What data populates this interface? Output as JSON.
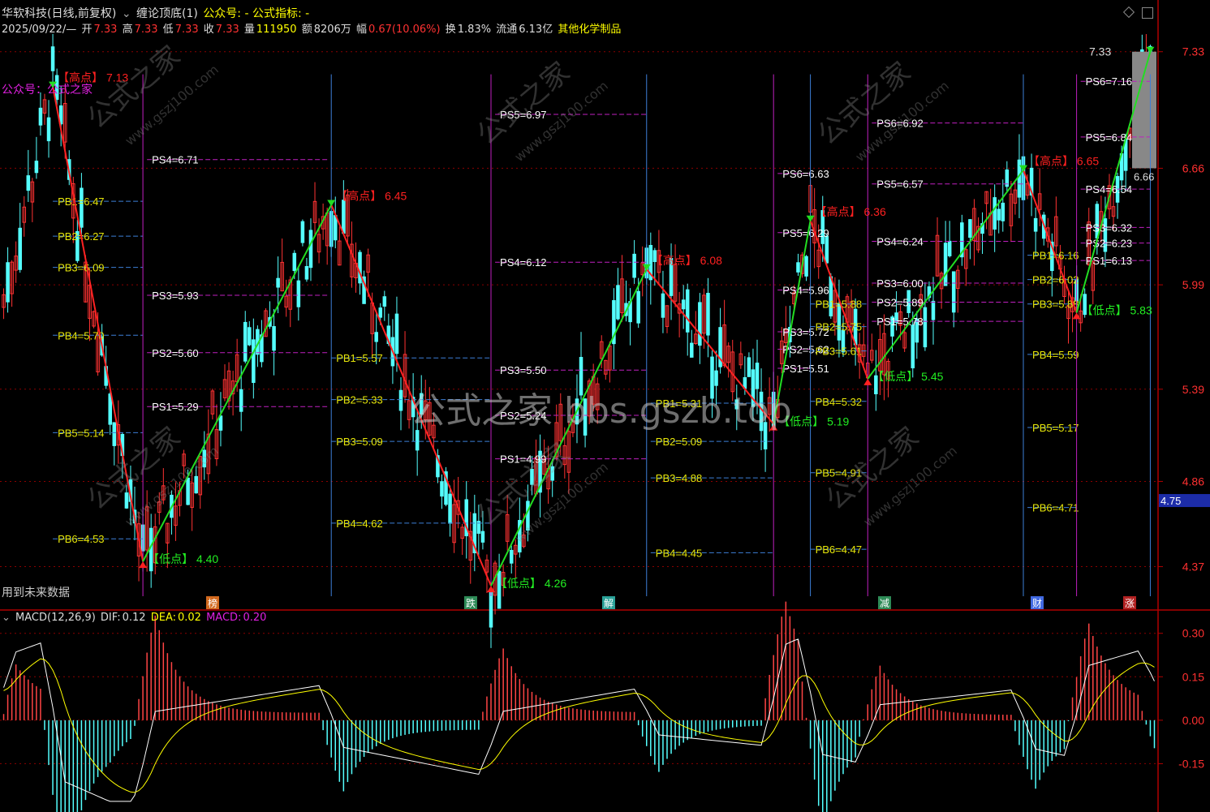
{
  "header": {
    "stock_name": "华软科技(日线,前复权)",
    "indicator_title": "缠论顶底(1)",
    "wechat_label": "公众号: - 公式指标: -",
    "date": "2025/09/22/—",
    "open_label": "开",
    "open": "7.33",
    "high_label": "高",
    "high": "7.33",
    "low_label": "低",
    "low": "7.33",
    "close_label": "收",
    "close": "7.33",
    "vol_label": "量",
    "volume": "111950",
    "amt_label": "额",
    "amount": "8206万",
    "chg_label": "幅",
    "change": "0.67(10.06%)",
    "turnover_label": "换",
    "turnover": "1.83%",
    "float_label": "流通",
    "float_cap": "6.13亿",
    "sector": "其他化学制品"
  },
  "overlay": {
    "wechat_tag": "公众号：公式之家",
    "future_data": "用到未来数据",
    "watermark": "公式之家 bbs.gszb.top",
    "site_watermark": "www.gszj100.com",
    "cn_watermark": "公式之家"
  },
  "markers": [
    {
      "label": "榜",
      "color": "#d2691e"
    },
    {
      "label": "跌",
      "color": "#2e8b57"
    },
    {
      "label": "解",
      "color": "#2aa198"
    },
    {
      "label": "减",
      "color": "#2e8b57"
    },
    {
      "label": "财",
      "color": "#4169e1"
    },
    {
      "label": "涨",
      "color": "#b22222"
    }
  ],
  "price_axis": {
    "ticks": [
      "7.33",
      "6.66",
      "5.99",
      "5.39",
      "4.86",
      "4.37"
    ],
    "current_badge": "4.75",
    "last_price": "7.33",
    "last_label2": "6.66"
  },
  "macd": {
    "title": "MACD(12,26,9)",
    "dif_label": "DIF:",
    "dif": "0.12",
    "dea_label": "DEA:",
    "dea": "0.02",
    "macd_label": "MACD:",
    "macd": "0.20",
    "ticks": [
      "0.30",
      "0.15",
      "0.00",
      "-0.15"
    ]
  },
  "chart_data": {
    "type": "line",
    "title": "缠论顶底",
    "pivots": [
      {
        "kind": "high",
        "label": "【高点】",
        "value": "7.13",
        "price": 7.13,
        "idx": 12
      },
      {
        "kind": "low",
        "label": "【低点】",
        "value": "4.40",
        "price": 4.4,
        "idx": 34
      },
      {
        "kind": "high",
        "label": "【高点】",
        "value": "6.45",
        "price": 6.45,
        "idx": 80
      },
      {
        "kind": "low",
        "label": "【低点】",
        "value": "4.26",
        "price": 4.26,
        "idx": 119
      },
      {
        "kind": "high",
        "label": "【高点】",
        "value": "6.08",
        "price": 6.08,
        "idx": 157
      },
      {
        "kind": "low",
        "label": "【低点】",
        "value": "5.19",
        "price": 5.19,
        "idx": 188
      },
      {
        "kind": "high",
        "label": "【高点】",
        "value": "6.36",
        "price": 6.36,
        "idx": 197
      },
      {
        "kind": "low",
        "label": "【低点】",
        "value": "5.45",
        "price": 5.45,
        "idx": 211
      },
      {
        "kind": "high",
        "label": "【高点】",
        "value": "6.65",
        "price": 6.65,
        "idx": 249
      },
      {
        "kind": "low",
        "label": "【低点】",
        "value": "5.83",
        "price": 5.83,
        "idx": 262
      },
      {
        "kind": "high",
        "label": "",
        "value": "7.33",
        "price": 7.33,
        "idx": 280
      }
    ],
    "levels": [
      {
        "text": "PB1=6.47",
        "p": 6.47,
        "from": 12,
        "to": 34,
        "type": "pb"
      },
      {
        "text": "PB2=6.27",
        "p": 6.27,
        "from": 12,
        "to": 34,
        "type": "pb"
      },
      {
        "text": "PB3=6.09",
        "p": 6.09,
        "from": 12,
        "to": 34,
        "type": "pb"
      },
      {
        "text": "PB4=5.70",
        "p": 5.7,
        "from": 12,
        "to": 34,
        "type": "pb"
      },
      {
        "text": "PB5=5.14",
        "p": 5.14,
        "from": 12,
        "to": 34,
        "type": "pb"
      },
      {
        "text": "PB6=4.53",
        "p": 4.53,
        "from": 12,
        "to": 34,
        "type": "pb"
      },
      {
        "text": "PS4=6.71",
        "p": 6.71,
        "from": 35,
        "to": 79,
        "type": "ps"
      },
      {
        "text": "PS3=5.93",
        "p": 5.93,
        "from": 35,
        "to": 79,
        "type": "ps"
      },
      {
        "text": "PS2=5.60",
        "p": 5.6,
        "from": 35,
        "to": 79,
        "type": "ps"
      },
      {
        "text": "PS1=5.29",
        "p": 5.29,
        "from": 35,
        "to": 79,
        "type": "ps"
      },
      {
        "text": "PB1=5.57",
        "p": 5.57,
        "from": 80,
        "to": 119,
        "type": "pb"
      },
      {
        "text": "PB2=5.33",
        "p": 5.33,
        "from": 80,
        "to": 119,
        "type": "pb"
      },
      {
        "text": "PB3=5.09",
        "p": 5.09,
        "from": 80,
        "to": 119,
        "type": "pb"
      },
      {
        "text": "PB4=4.62",
        "p": 4.62,
        "from": 80,
        "to": 119,
        "type": "pb"
      },
      {
        "text": "PS5=6.97",
        "p": 6.97,
        "from": 120,
        "to": 157,
        "type": "ps"
      },
      {
        "text": "PS4=6.12",
        "p": 6.12,
        "from": 120,
        "to": 157,
        "type": "ps"
      },
      {
        "text": "PS3=5.50",
        "p": 5.5,
        "from": 120,
        "to": 157,
        "type": "ps"
      },
      {
        "text": "PS2=5.24",
        "p": 5.24,
        "from": 120,
        "to": 157,
        "type": "ps"
      },
      {
        "text": "PS1=4.99",
        "p": 4.99,
        "from": 120,
        "to": 157,
        "type": "ps"
      },
      {
        "text": "PB1=5.31",
        "p": 5.31,
        "from": 158,
        "to": 188,
        "type": "pb"
      },
      {
        "text": "PB2=5.09",
        "p": 5.09,
        "from": 158,
        "to": 188,
        "type": "pb"
      },
      {
        "text": "PB3=4.88",
        "p": 4.88,
        "from": 158,
        "to": 188,
        "type": "pb"
      },
      {
        "text": "PB4=4.45",
        "p": 4.45,
        "from": 158,
        "to": 188,
        "type": "pb"
      },
      {
        "text": "PS6=6.63",
        "p": 6.63,
        "from": 189,
        "to": 197,
        "type": "ps"
      },
      {
        "text": "PS5=6.29",
        "p": 6.29,
        "from": 189,
        "to": 197,
        "type": "ps"
      },
      {
        "text": "PS4=5.96",
        "p": 5.96,
        "from": 189,
        "to": 197,
        "type": "ps"
      },
      {
        "text": "PS3=5.72",
        "p": 5.72,
        "from": 189,
        "to": 197,
        "type": "ps"
      },
      {
        "text": "PS2=5.62",
        "p": 5.62,
        "from": 189,
        "to": 197,
        "type": "ps"
      },
      {
        "text": "PS1=5.51",
        "p": 5.51,
        "from": 189,
        "to": 197,
        "type": "ps"
      },
      {
        "text": "PB1=5.88",
        "p": 5.88,
        "from": 197,
        "to": 211,
        "type": "pb"
      },
      {
        "text": "PB2=5.75",
        "p": 5.75,
        "from": 197,
        "to": 211,
        "type": "pb"
      },
      {
        "text": "PB3=5.61",
        "p": 5.61,
        "from": 197,
        "to": 211,
        "type": "pb"
      },
      {
        "text": "PB4=5.32",
        "p": 5.32,
        "from": 197,
        "to": 211,
        "type": "pb"
      },
      {
        "text": "PB5=4.91",
        "p": 4.91,
        "from": 197,
        "to": 211,
        "type": "pb"
      },
      {
        "text": "PB6=4.47",
        "p": 4.47,
        "from": 197,
        "to": 211,
        "type": "pb"
      },
      {
        "text": "PS6=6.92",
        "p": 6.92,
        "from": 212,
        "to": 249,
        "type": "ps"
      },
      {
        "text": "PS5=6.57",
        "p": 6.57,
        "from": 212,
        "to": 249,
        "type": "ps"
      },
      {
        "text": "PS4=6.24",
        "p": 6.24,
        "from": 212,
        "to": 249,
        "type": "ps"
      },
      {
        "text": "PS3=6.00",
        "p": 6.0,
        "from": 212,
        "to": 249,
        "type": "ps"
      },
      {
        "text": "PS2=5.89",
        "p": 5.89,
        "from": 212,
        "to": 249,
        "type": "ps"
      },
      {
        "text": "PS1=5.78",
        "p": 5.78,
        "from": 212,
        "to": 249,
        "type": "ps"
      },
      {
        "text": "PB1=6.16",
        "p": 6.16,
        "from": 250,
        "to": 262,
        "type": "pb"
      },
      {
        "text": "PB2=6.02",
        "p": 6.02,
        "from": 250,
        "to": 262,
        "type": "pb"
      },
      {
        "text": "PB3=5.88",
        "p": 5.88,
        "from": 250,
        "to": 262,
        "type": "pb"
      },
      {
        "text": "PB4=5.59",
        "p": 5.59,
        "from": 250,
        "to": 262,
        "type": "pb"
      },
      {
        "text": "PB5=5.17",
        "p": 5.17,
        "from": 250,
        "to": 262,
        "type": "pb"
      },
      {
        "text": "PB6=4.71",
        "p": 4.71,
        "from": 250,
        "to": 262,
        "type": "pb"
      },
      {
        "text": "PS6=7.16",
        "p": 7.16,
        "from": 263,
        "to": 280,
        "type": "ps"
      },
      {
        "text": "PS5=6.84",
        "p": 6.84,
        "from": 263,
        "to": 280,
        "type": "ps"
      },
      {
        "text": "PS4=6.54",
        "p": 6.54,
        "from": 263,
        "to": 280,
        "type": "ps"
      },
      {
        "text": "PS3=6.32",
        "p": 6.32,
        "from": 263,
        "to": 280,
        "type": "ps"
      },
      {
        "text": "PS2=6.23",
        "p": 6.23,
        "from": 263,
        "to": 280,
        "type": "ps"
      },
      {
        "text": "PS1=6.13",
        "p": 6.13,
        "from": 263,
        "to": 280,
        "type": "ps"
      }
    ],
    "ylim": [
      4.2,
      7.45
    ],
    "bars": 282,
    "colors": {
      "up": "#ff3232",
      "down": "#54ffff",
      "zig_up": "#22dd22",
      "zig_down": "#ff2222",
      "pb": "#3d7fd8",
      "ps": "#c020c0",
      "pb_text": "#e6e60a",
      "ps_text": "#ffffff",
      "grid": "#8b0000"
    }
  }
}
